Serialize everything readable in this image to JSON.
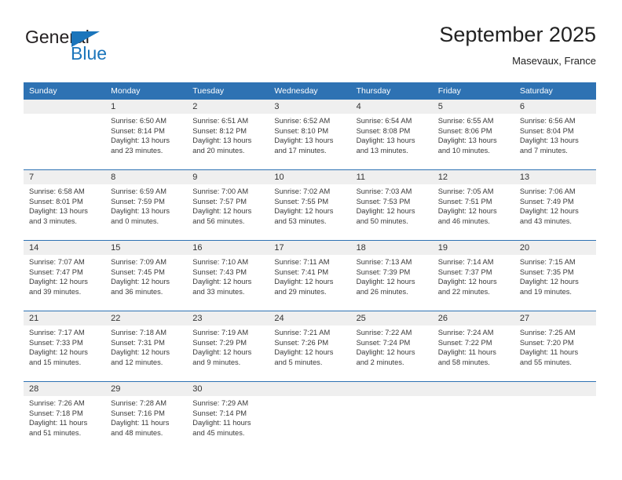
{
  "brand": {
    "name_top": "General",
    "name_bottom": "Blue",
    "triangle_color": "#1b75bb",
    "top_color": "#231f20"
  },
  "header": {
    "title": "September 2025",
    "subtitle": "Masevaux, France"
  },
  "theme": {
    "header_blue": "#2e72b3",
    "date_band_gray": "#efefef",
    "body_white": "#ffffff",
    "text_color": "#3a3a3a"
  },
  "calendar": {
    "weekday_headers": [
      "Sunday",
      "Monday",
      "Tuesday",
      "Wednesday",
      "Thursday",
      "Friday",
      "Saturday"
    ],
    "weeks": [
      [
        {
          "day": "",
          "sunrise": "",
          "sunset": "",
          "daylight_1": "",
          "daylight_2": ""
        },
        {
          "day": "1",
          "sunrise": "Sunrise: 6:50 AM",
          "sunset": "Sunset: 8:14 PM",
          "daylight_1": "Daylight: 13 hours",
          "daylight_2": "and 23 minutes."
        },
        {
          "day": "2",
          "sunrise": "Sunrise: 6:51 AM",
          "sunset": "Sunset: 8:12 PM",
          "daylight_1": "Daylight: 13 hours",
          "daylight_2": "and 20 minutes."
        },
        {
          "day": "3",
          "sunrise": "Sunrise: 6:52 AM",
          "sunset": "Sunset: 8:10 PM",
          "daylight_1": "Daylight: 13 hours",
          "daylight_2": "and 17 minutes."
        },
        {
          "day": "4",
          "sunrise": "Sunrise: 6:54 AM",
          "sunset": "Sunset: 8:08 PM",
          "daylight_1": "Daylight: 13 hours",
          "daylight_2": "and 13 minutes."
        },
        {
          "day": "5",
          "sunrise": "Sunrise: 6:55 AM",
          "sunset": "Sunset: 8:06 PM",
          "daylight_1": "Daylight: 13 hours",
          "daylight_2": "and 10 minutes."
        },
        {
          "day": "6",
          "sunrise": "Sunrise: 6:56 AM",
          "sunset": "Sunset: 8:04 PM",
          "daylight_1": "Daylight: 13 hours",
          "daylight_2": "and 7 minutes."
        }
      ],
      [
        {
          "day": "7",
          "sunrise": "Sunrise: 6:58 AM",
          "sunset": "Sunset: 8:01 PM",
          "daylight_1": "Daylight: 13 hours",
          "daylight_2": "and 3 minutes."
        },
        {
          "day": "8",
          "sunrise": "Sunrise: 6:59 AM",
          "sunset": "Sunset: 7:59 PM",
          "daylight_1": "Daylight: 13 hours",
          "daylight_2": "and 0 minutes."
        },
        {
          "day": "9",
          "sunrise": "Sunrise: 7:00 AM",
          "sunset": "Sunset: 7:57 PM",
          "daylight_1": "Daylight: 12 hours",
          "daylight_2": "and 56 minutes."
        },
        {
          "day": "10",
          "sunrise": "Sunrise: 7:02 AM",
          "sunset": "Sunset: 7:55 PM",
          "daylight_1": "Daylight: 12 hours",
          "daylight_2": "and 53 minutes."
        },
        {
          "day": "11",
          "sunrise": "Sunrise: 7:03 AM",
          "sunset": "Sunset: 7:53 PM",
          "daylight_1": "Daylight: 12 hours",
          "daylight_2": "and 50 minutes."
        },
        {
          "day": "12",
          "sunrise": "Sunrise: 7:05 AM",
          "sunset": "Sunset: 7:51 PM",
          "daylight_1": "Daylight: 12 hours",
          "daylight_2": "and 46 minutes."
        },
        {
          "day": "13",
          "sunrise": "Sunrise: 7:06 AM",
          "sunset": "Sunset: 7:49 PM",
          "daylight_1": "Daylight: 12 hours",
          "daylight_2": "and 43 minutes."
        }
      ],
      [
        {
          "day": "14",
          "sunrise": "Sunrise: 7:07 AM",
          "sunset": "Sunset: 7:47 PM",
          "daylight_1": "Daylight: 12 hours",
          "daylight_2": "and 39 minutes."
        },
        {
          "day": "15",
          "sunrise": "Sunrise: 7:09 AM",
          "sunset": "Sunset: 7:45 PM",
          "daylight_1": "Daylight: 12 hours",
          "daylight_2": "and 36 minutes."
        },
        {
          "day": "16",
          "sunrise": "Sunrise: 7:10 AM",
          "sunset": "Sunset: 7:43 PM",
          "daylight_1": "Daylight: 12 hours",
          "daylight_2": "and 33 minutes."
        },
        {
          "day": "17",
          "sunrise": "Sunrise: 7:11 AM",
          "sunset": "Sunset: 7:41 PM",
          "daylight_1": "Daylight: 12 hours",
          "daylight_2": "and 29 minutes."
        },
        {
          "day": "18",
          "sunrise": "Sunrise: 7:13 AM",
          "sunset": "Sunset: 7:39 PM",
          "daylight_1": "Daylight: 12 hours",
          "daylight_2": "and 26 minutes."
        },
        {
          "day": "19",
          "sunrise": "Sunrise: 7:14 AM",
          "sunset": "Sunset: 7:37 PM",
          "daylight_1": "Daylight: 12 hours",
          "daylight_2": "and 22 minutes."
        },
        {
          "day": "20",
          "sunrise": "Sunrise: 7:15 AM",
          "sunset": "Sunset: 7:35 PM",
          "daylight_1": "Daylight: 12 hours",
          "daylight_2": "and 19 minutes."
        }
      ],
      [
        {
          "day": "21",
          "sunrise": "Sunrise: 7:17 AM",
          "sunset": "Sunset: 7:33 PM",
          "daylight_1": "Daylight: 12 hours",
          "daylight_2": "and 15 minutes."
        },
        {
          "day": "22",
          "sunrise": "Sunrise: 7:18 AM",
          "sunset": "Sunset: 7:31 PM",
          "daylight_1": "Daylight: 12 hours",
          "daylight_2": "and 12 minutes."
        },
        {
          "day": "23",
          "sunrise": "Sunrise: 7:19 AM",
          "sunset": "Sunset: 7:29 PM",
          "daylight_1": "Daylight: 12 hours",
          "daylight_2": "and 9 minutes."
        },
        {
          "day": "24",
          "sunrise": "Sunrise: 7:21 AM",
          "sunset": "Sunset: 7:26 PM",
          "daylight_1": "Daylight: 12 hours",
          "daylight_2": "and 5 minutes."
        },
        {
          "day": "25",
          "sunrise": "Sunrise: 7:22 AM",
          "sunset": "Sunset: 7:24 PM",
          "daylight_1": "Daylight: 12 hours",
          "daylight_2": "and 2 minutes."
        },
        {
          "day": "26",
          "sunrise": "Sunrise: 7:24 AM",
          "sunset": "Sunset: 7:22 PM",
          "daylight_1": "Daylight: 11 hours",
          "daylight_2": "and 58 minutes."
        },
        {
          "day": "27",
          "sunrise": "Sunrise: 7:25 AM",
          "sunset": "Sunset: 7:20 PM",
          "daylight_1": "Daylight: 11 hours",
          "daylight_2": "and 55 minutes."
        }
      ],
      [
        {
          "day": "28",
          "sunrise": "Sunrise: 7:26 AM",
          "sunset": "Sunset: 7:18 PM",
          "daylight_1": "Daylight: 11 hours",
          "daylight_2": "and 51 minutes."
        },
        {
          "day": "29",
          "sunrise": "Sunrise: 7:28 AM",
          "sunset": "Sunset: 7:16 PM",
          "daylight_1": "Daylight: 11 hours",
          "daylight_2": "and 48 minutes."
        },
        {
          "day": "30",
          "sunrise": "Sunrise: 7:29 AM",
          "sunset": "Sunset: 7:14 PM",
          "daylight_1": "Daylight: 11 hours",
          "daylight_2": "and 45 minutes."
        },
        {
          "day": "",
          "sunrise": "",
          "sunset": "",
          "daylight_1": "",
          "daylight_2": ""
        },
        {
          "day": "",
          "sunrise": "",
          "sunset": "",
          "daylight_1": "",
          "daylight_2": ""
        },
        {
          "day": "",
          "sunrise": "",
          "sunset": "",
          "daylight_1": "",
          "daylight_2": ""
        },
        {
          "day": "",
          "sunrise": "",
          "sunset": "",
          "daylight_1": "",
          "daylight_2": ""
        }
      ]
    ]
  }
}
